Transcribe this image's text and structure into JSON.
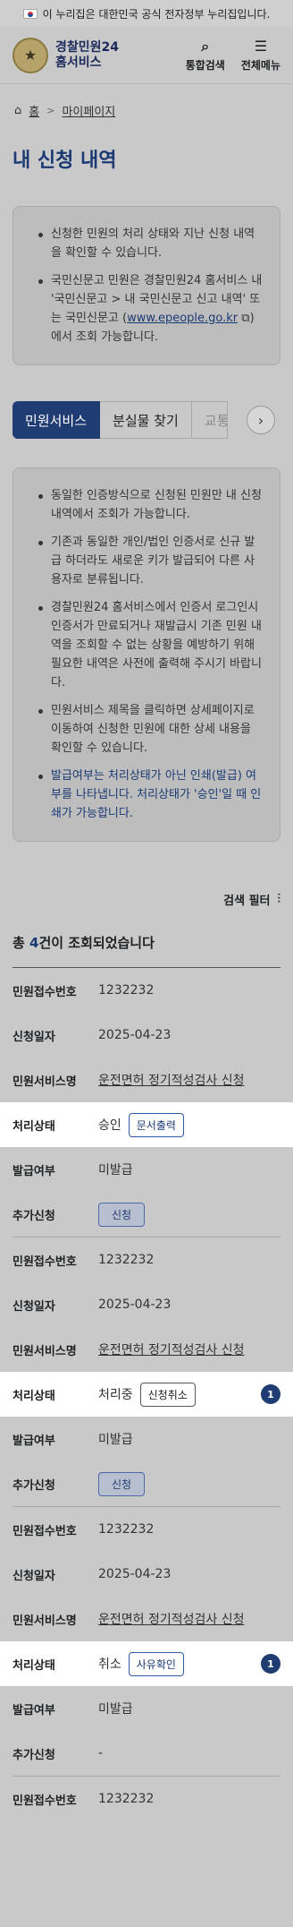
{
  "gov_banner": {
    "text": "이 누리집은 대한민국 공식 전자정부 누리집입니다."
  },
  "header": {
    "logo_line1": "경찰민원24",
    "logo_line2": "홈서비스",
    "search_label": "통합검색",
    "menu_label": "전체메뉴"
  },
  "breadcrumb": {
    "home": "홈",
    "current": "마이페이지"
  },
  "page_title": "내 신청 내역",
  "info1": {
    "item1": "신청한 민원의 처리 상태와 지난 신청 내역을 확인할 수 있습니다.",
    "item2_pre": "국민신문고 민원은 경찰민원24 홈서비스 내 '국민신문고 > 내 국민신문고 신고 내역' 또는 국민신문고 (",
    "item2_link": "www.epeople.go.kr",
    "item2_post": ") 에서 조회 가능합니다."
  },
  "tabs": [
    {
      "label": "민원서비스"
    },
    {
      "label": "분실물 찾기"
    },
    {
      "label": "교통"
    }
  ],
  "info2": {
    "item1": "동일한 인증방식으로 신청된 민원만 내 신청 내역에서 조회가 가능합니다.",
    "item2": "기존과 동일한 개인/법인 인증서로 신규 발급 하더라도 새로운 키가 발급되어 다른 사용자로 분류됩니다.",
    "item3": "경찰민원24 홈서비스에서 인증서 로그인시 인증서가 만료되거나 재발급시 기존 민원 내역을 조회할 수 없는 상황을 예방하기 위해 필요한 내역은 사전에 출력해 주시기 바랍니다.",
    "item4": "민원서비스 제목을 클릭하면 상세페이지로 이동하여 신청한 민원에 대한 상세 내용을 확인할 수 있습니다.",
    "item5": "발급여부는 처리상태가 아닌 인쇄(발급) 여부를 나타냅니다. 처리상태가 '승인'일 때 인쇄가 가능합니다."
  },
  "filter": {
    "label": "검색 필터"
  },
  "result": {
    "pre": "총 ",
    "count": "4",
    "post": "건이 조회되었습니다"
  },
  "labels": {
    "receipt_no": "민원접수번호",
    "date": "신청일자",
    "service": "민원서비스명",
    "status": "처리상태",
    "issued": "발급여부",
    "extra": "추가신청"
  },
  "records": [
    {
      "receipt_no": "1232232",
      "date": "2025-04-23",
      "service": "운전면허 정기적성검사 신청",
      "status": "승인",
      "status_btn": "문서출력",
      "issued": "미발급",
      "extra_btn": "신청"
    },
    {
      "receipt_no": "1232232",
      "date": "2025-04-23",
      "service": "운전면허 정기적성검사 신청",
      "status": "처리중",
      "status_btn": "신청취소",
      "badge": "1",
      "issued": "미발급",
      "extra_btn": "신청"
    },
    {
      "receipt_no": "1232232",
      "date": "2025-04-23",
      "service": "운전면허 정기적성검사 신청",
      "status": "취소",
      "status_btn": "사유확인",
      "badge": "1",
      "issued": "미발급",
      "extra": "-"
    },
    {
      "receipt_no": "1232232"
    }
  ]
}
